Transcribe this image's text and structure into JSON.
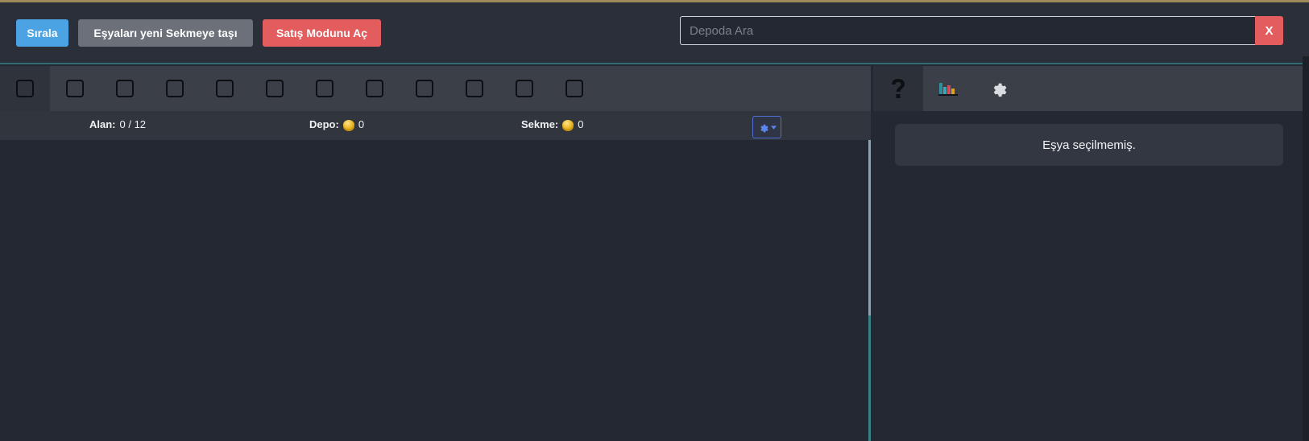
{
  "toolbar": {
    "sort_label": "Sırala",
    "move_label": "Eşyaları yeni Sekmeye taşı",
    "sell_label": "Satış Modunu Aç",
    "search_placeholder": "Depoda Ara",
    "clear_label": "X"
  },
  "tabs": {
    "count": 12,
    "active_index": 0
  },
  "stats": {
    "area_label": "Alan:",
    "area_value": "0 / 12",
    "depot_label": "Depo:",
    "depot_value": "0",
    "tab_label": "Sekme:",
    "tab_value": "0"
  },
  "right_panel": {
    "tabs": [
      {
        "icon": "question-icon"
      },
      {
        "icon": "chart-icon"
      },
      {
        "icon": "gear-icon"
      }
    ],
    "empty_message": "Eşya seçilmemiş."
  },
  "colors": {
    "accent_blue": "#4ba3e3",
    "danger_red": "#e35d5f",
    "neutral_gray": "#6b7079",
    "teal_border": "#3d7f86",
    "gold_line": "#9c8a5a"
  }
}
